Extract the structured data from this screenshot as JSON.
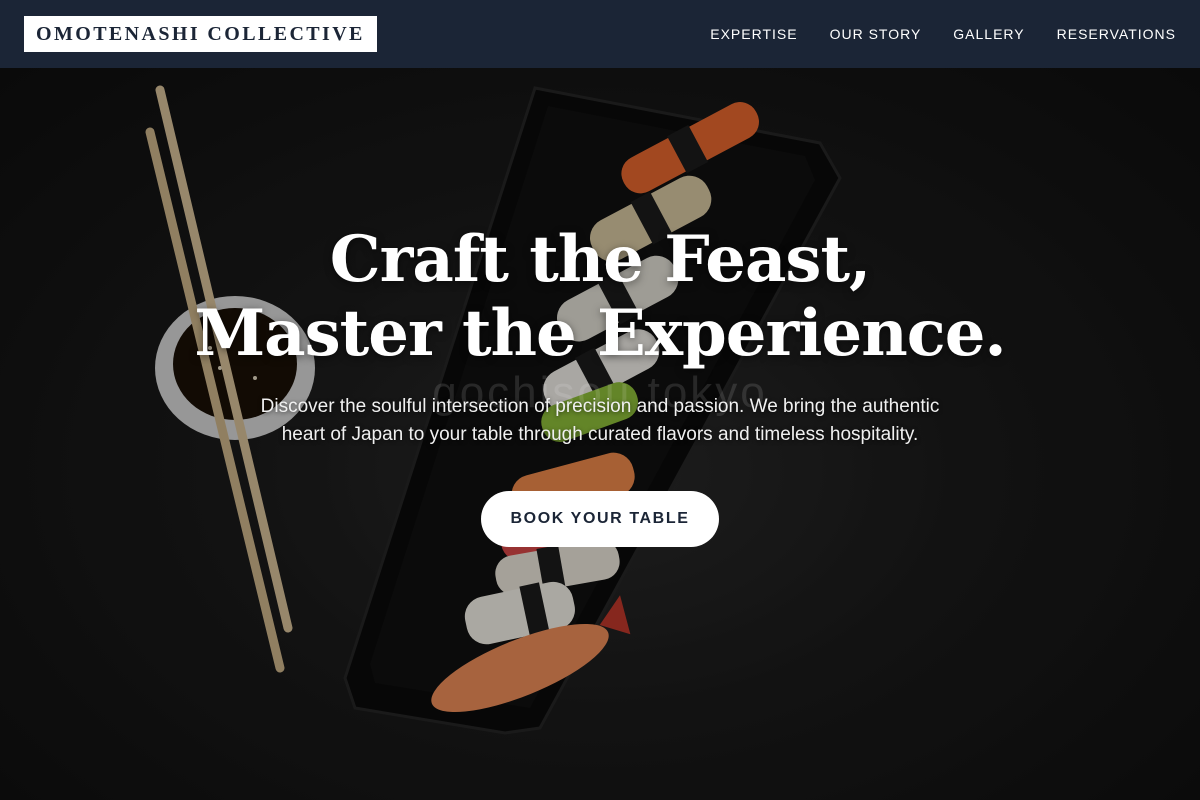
{
  "nav": {
    "logo": "OMOTENASHI COLLECTIVE",
    "links": [
      "EXPERTISE",
      "OUR STORY",
      "GALLERY",
      "RESERVATIONS"
    ]
  },
  "hero": {
    "headline_line1": "Craft the Feast,",
    "headline_line2": "Master the Experience.",
    "subtitle": "Discover the soulful intersection of precision and passion. We bring the authentic heart of Japan to your table through curated flavors and timeless hospitality.",
    "cta_label": "BOOK YOUR TABLE",
    "watermark": "gochisou tokyo"
  },
  "colors": {
    "nav_bg": "#1b2536",
    "logo_bg": "#ffffff",
    "cta_bg": "#ffffff",
    "cta_text": "#1b2536"
  },
  "icons": [
    "chopsticks-image",
    "soy-sauce-bowl-image",
    "sushi-platter-image"
  ]
}
